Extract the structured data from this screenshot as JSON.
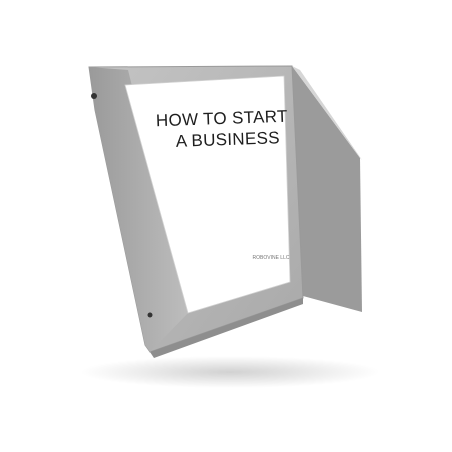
{
  "binder": {
    "title_line1": "HOW TO START",
    "title_line2": "A BUSINESS",
    "publisher": "ROBOVINE LLC"
  },
  "colors": {
    "binder_cover": "#b9b9b9",
    "binder_edge": "#8f8f8f",
    "label_paper": "#ffffff",
    "ring": "#333333"
  }
}
